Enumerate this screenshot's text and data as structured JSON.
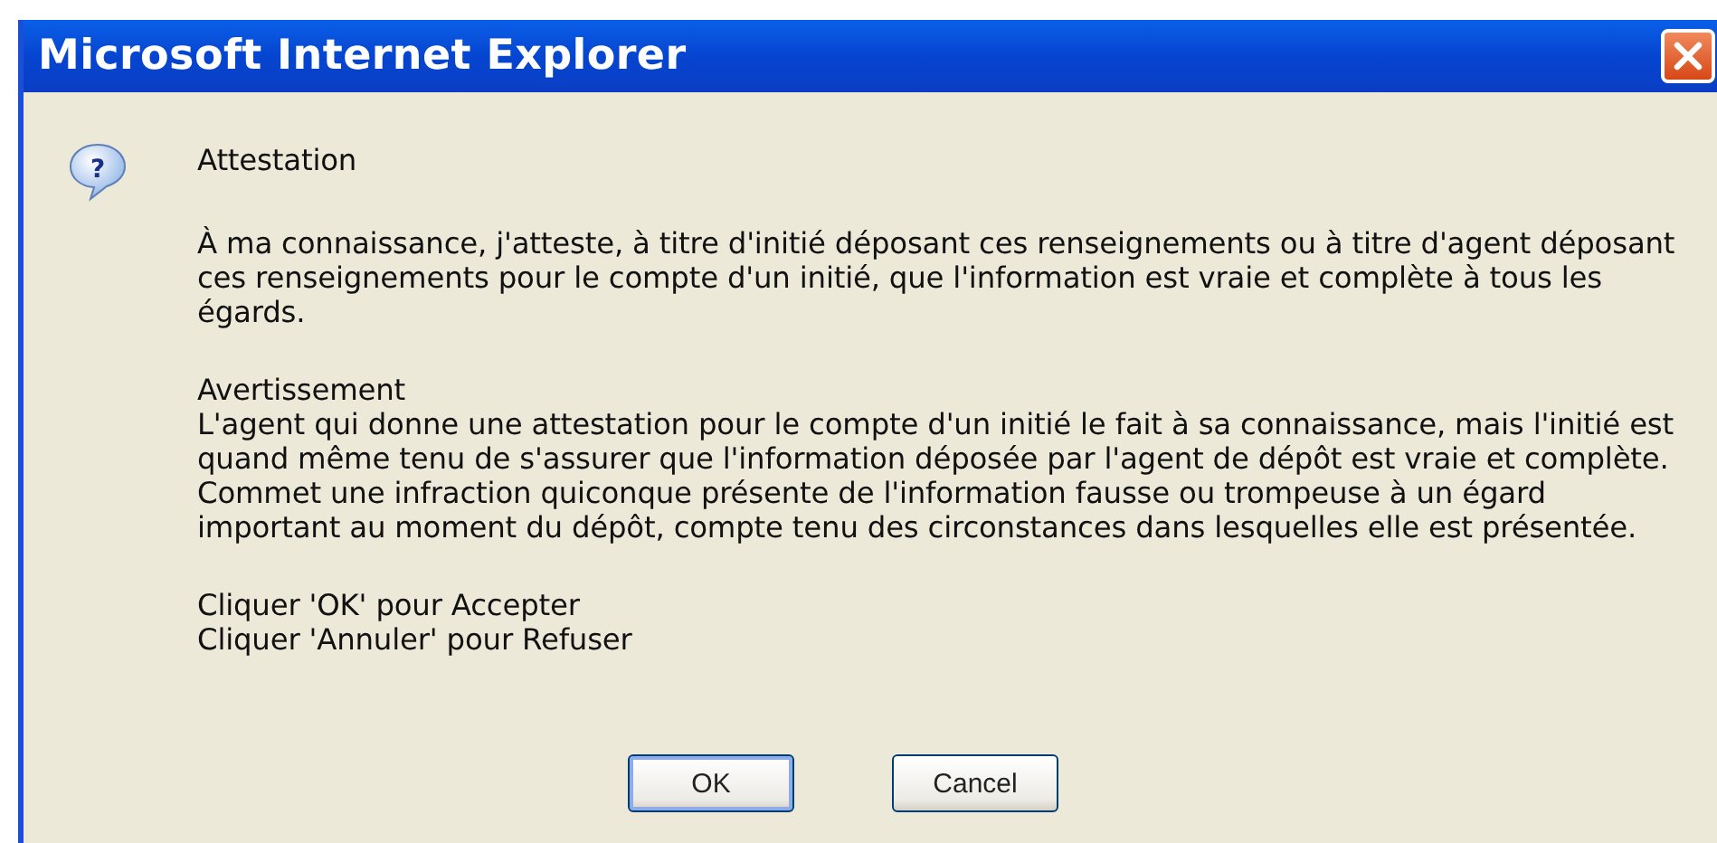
{
  "window": {
    "title": "Microsoft Internet Explorer"
  },
  "icon_glyph": "?",
  "heading": "Attestation",
  "paragraphs": [
    {
      "lines": [
        "À ma connaissance, j'atteste, à titre d'initié déposant ces renseignements ou à titre d'agent déposant",
        "ces renseignements pour le compte d'un initié, que l'information est vraie et complète à tous les",
        "égards."
      ]
    },
    {
      "lines": [
        "Avertissement",
        "L'agent qui donne une attestation pour le compte d'un initié le fait à sa connaissance, mais l'initié est",
        "quand même tenu de s'assurer que l'information déposée par l'agent de dépôt est vraie et complète.",
        "Commet une infraction quiconque présente de l'information fausse ou trompeuse à un égard",
        "important au moment du dépôt, compte tenu des circonstances dans lesquelles elle est présentée."
      ]
    },
    {
      "lines": [
        "Cliquer 'OK' pour Accepter",
        "Cliquer 'Annuler' pour Refuser"
      ]
    }
  ],
  "buttons": [
    {
      "label": "OK",
      "selected": true
    },
    {
      "label": "Cancel",
      "selected": false
    }
  ]
}
